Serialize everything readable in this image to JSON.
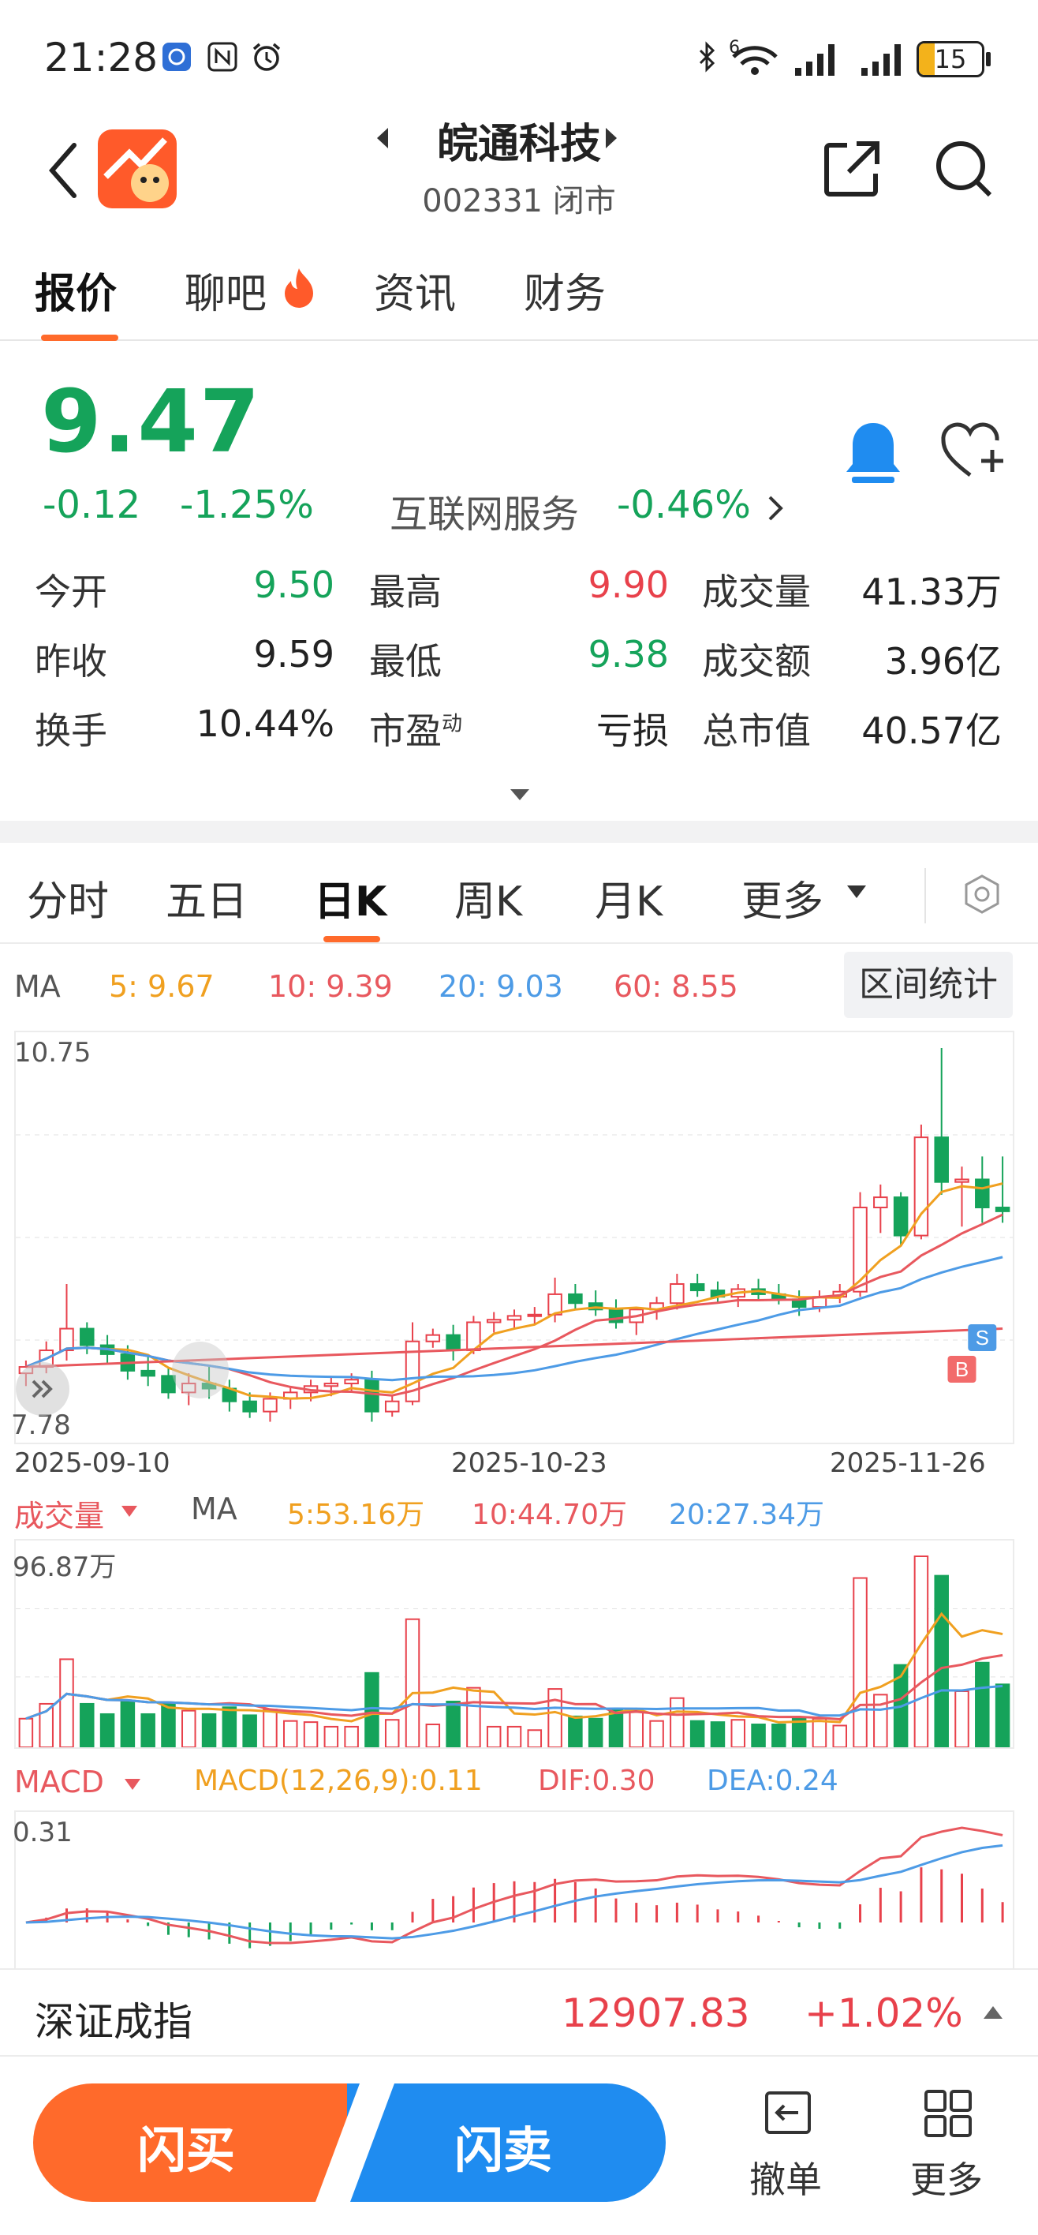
{
  "status_bar": {
    "time": "21:28",
    "battery": "15",
    "network_badge": "6"
  },
  "header": {
    "stock_name": "皖通科技",
    "stock_code_status": "002331 闭市"
  },
  "tabs": [
    {
      "label": "报价",
      "active": true
    },
    {
      "label": "聊吧",
      "active": false
    },
    {
      "label": "资讯",
      "active": false
    },
    {
      "label": "财务",
      "active": false
    }
  ],
  "quote": {
    "price": "9.47",
    "change": "-0.12",
    "change_pct": "-1.25%",
    "sector_name": "互联网服务",
    "sector_change": "-0.46%",
    "rows": [
      [
        {
          "label": "今开",
          "value": "9.50",
          "color": "green"
        },
        {
          "label": "最高",
          "value": "9.90",
          "color": "red"
        },
        {
          "label": "成交量",
          "value": "41.33万",
          "color": "dark"
        }
      ],
      [
        {
          "label": "昨收",
          "value": "9.59",
          "color": "dark"
        },
        {
          "label": "最低",
          "value": "9.38",
          "color": "green"
        },
        {
          "label": "成交额",
          "value": "3.96亿",
          "color": "dark"
        }
      ],
      [
        {
          "label": "换手",
          "value": "10.44%",
          "color": "dark"
        },
        {
          "label": "市盈",
          "value": "亏损",
          "color": "dark",
          "sup": "动"
        },
        {
          "label": "总市值",
          "value": "40.57亿",
          "color": "dark"
        }
      ]
    ]
  },
  "kline_tabs": [
    {
      "label": "分时",
      "active": false
    },
    {
      "label": "五日",
      "active": false
    },
    {
      "label": "日K",
      "active": true
    },
    {
      "label": "周K",
      "active": false
    },
    {
      "label": "月K",
      "active": false
    },
    {
      "label": "更多",
      "active": false
    }
  ],
  "ma_legend": {
    "label": "MA",
    "items": [
      {
        "text": "5:  9.67",
        "color": "#f0a020"
      },
      {
        "text": "10:  9.39",
        "color": "#e8585e"
      },
      {
        "text": "20:  9.03",
        "color": "#4d9be6"
      },
      {
        "text": "60:  8.55",
        "color": "#e8585e"
      }
    ],
    "range_button": "区间统计"
  },
  "price_chart": {
    "y_max_label": "10.75",
    "y_min_label": "7.78",
    "x_labels": [
      "2025-09-10",
      "2025-10-23",
      "2025-11-26"
    ],
    "buy_marker": "B",
    "sell_marker": "S"
  },
  "volume_legend": {
    "title": "成交量",
    "label": "MA",
    "items": [
      {
        "text": "5:53.16万",
        "color": "#f0a020"
      },
      {
        "text": "10:44.70万",
        "color": "#e8585e"
      },
      {
        "text": "20:27.34万",
        "color": "#4d9be6"
      }
    ],
    "y_max_label": "96.87万"
  },
  "macd_legend": {
    "title": "MACD",
    "items": [
      {
        "text": "MACD(12,26,9):0.11",
        "color": "#f0a020"
      },
      {
        "text": "DIF:0.30",
        "color": "#e8585e"
      },
      {
        "text": "DEA:0.24",
        "color": "#4d9be6"
      }
    ],
    "y_max_label": "0.31"
  },
  "index_bar": {
    "name": "深证成指",
    "value": "12907.83",
    "change": "+1.02%"
  },
  "bottom": {
    "buy": "闪买",
    "sell": "闪卖",
    "cancel": "撤单",
    "more": "更多"
  },
  "chart_data": {
    "type": "candlestick",
    "x_range": [
      "2025-09-10",
      "2025-11-28"
    ],
    "ylim": [
      7.78,
      10.75
    ],
    "candles": [
      {
        "o": 8.2,
        "h": 8.3,
        "l": 8.1,
        "c": 8.25
      },
      {
        "o": 8.25,
        "h": 8.45,
        "l": 8.2,
        "c": 8.38
      },
      {
        "o": 8.38,
        "h": 8.9,
        "l": 8.3,
        "c": 8.55
      },
      {
        "o": 8.55,
        "h": 8.6,
        "l": 8.35,
        "c": 8.42
      },
      {
        "o": 8.42,
        "h": 8.5,
        "l": 8.28,
        "c": 8.35
      },
      {
        "o": 8.35,
        "h": 8.42,
        "l": 8.15,
        "c": 8.22
      },
      {
        "o": 8.22,
        "h": 8.35,
        "l": 8.1,
        "c": 8.18
      },
      {
        "o": 8.18,
        "h": 8.25,
        "l": 8.0,
        "c": 8.05
      },
      {
        "o": 8.05,
        "h": 8.2,
        "l": 7.95,
        "c": 8.12
      },
      {
        "o": 8.12,
        "h": 8.25,
        "l": 8.0,
        "c": 8.08
      },
      {
        "o": 8.08,
        "h": 8.15,
        "l": 7.9,
        "c": 7.98
      },
      {
        "o": 7.98,
        "h": 8.05,
        "l": 7.85,
        "c": 7.9
      },
      {
        "o": 7.9,
        "h": 8.05,
        "l": 7.82,
        "c": 8.0
      },
      {
        "o": 8.0,
        "h": 8.1,
        "l": 7.92,
        "c": 8.05
      },
      {
        "o": 8.05,
        "h": 8.15,
        "l": 7.98,
        "c": 8.1
      },
      {
        "o": 8.1,
        "h": 8.18,
        "l": 8.02,
        "c": 8.12
      },
      {
        "o": 8.12,
        "h": 8.2,
        "l": 8.05,
        "c": 8.15
      },
      {
        "o": 8.15,
        "h": 8.22,
        "l": 7.82,
        "c": 7.9
      },
      {
        "o": 7.9,
        "h": 8.02,
        "l": 7.86,
        "c": 7.98
      },
      {
        "o": 7.98,
        "h": 8.6,
        "l": 7.95,
        "c": 8.45
      },
      {
        "o": 8.45,
        "h": 8.55,
        "l": 8.4,
        "c": 8.5
      },
      {
        "o": 8.5,
        "h": 8.58,
        "l": 8.3,
        "c": 8.38
      },
      {
        "o": 8.38,
        "h": 8.65,
        "l": 8.35,
        "c": 8.6
      },
      {
        "o": 8.6,
        "h": 8.68,
        "l": 8.52,
        "c": 8.62
      },
      {
        "o": 8.62,
        "h": 8.7,
        "l": 8.55,
        "c": 8.65
      },
      {
        "o": 8.65,
        "h": 8.72,
        "l": 8.58,
        "c": 8.66
      },
      {
        "o": 8.66,
        "h": 8.95,
        "l": 8.6,
        "c": 8.82
      },
      {
        "o": 8.82,
        "h": 8.9,
        "l": 8.7,
        "c": 8.75
      },
      {
        "o": 8.75,
        "h": 8.85,
        "l": 8.65,
        "c": 8.7
      },
      {
        "o": 8.7,
        "h": 8.78,
        "l": 8.55,
        "c": 8.6
      },
      {
        "o": 8.6,
        "h": 8.72,
        "l": 8.5,
        "c": 8.7
      },
      {
        "o": 8.7,
        "h": 8.8,
        "l": 8.62,
        "c": 8.75
      },
      {
        "o": 8.75,
        "h": 8.98,
        "l": 8.7,
        "c": 8.9
      },
      {
        "o": 8.9,
        "h": 8.98,
        "l": 8.8,
        "c": 8.85
      },
      {
        "o": 8.85,
        "h": 8.92,
        "l": 8.75,
        "c": 8.8
      },
      {
        "o": 8.8,
        "h": 8.9,
        "l": 8.72,
        "c": 8.86
      },
      {
        "o": 8.86,
        "h": 8.94,
        "l": 8.78,
        "c": 8.82
      },
      {
        "o": 8.82,
        "h": 8.9,
        "l": 8.74,
        "c": 8.78
      },
      {
        "o": 8.78,
        "h": 8.85,
        "l": 8.65,
        "c": 8.72
      },
      {
        "o": 8.72,
        "h": 8.85,
        "l": 8.68,
        "c": 8.8
      },
      {
        "o": 8.8,
        "h": 8.9,
        "l": 8.75,
        "c": 8.84
      },
      {
        "o": 8.84,
        "h": 9.62,
        "l": 8.8,
        "c": 9.5
      },
      {
        "o": 9.5,
        "h": 9.68,
        "l": 9.3,
        "c": 9.58
      },
      {
        "o": 9.58,
        "h": 9.62,
        "l": 9.2,
        "c": 9.28
      },
      {
        "o": 9.28,
        "h": 10.15,
        "l": 9.25,
        "c": 10.05
      },
      {
        "o": 10.05,
        "h": 10.75,
        "l": 9.6,
        "c": 9.7
      },
      {
        "o": 9.7,
        "h": 9.82,
        "l": 9.35,
        "c": 9.72
      },
      {
        "o": 9.72,
        "h": 9.9,
        "l": 9.38,
        "c": 9.5
      },
      {
        "o": 9.5,
        "h": 9.9,
        "l": 9.38,
        "c": 9.47
      }
    ],
    "volume_max": "96.87万",
    "macd_max": "0.31"
  }
}
